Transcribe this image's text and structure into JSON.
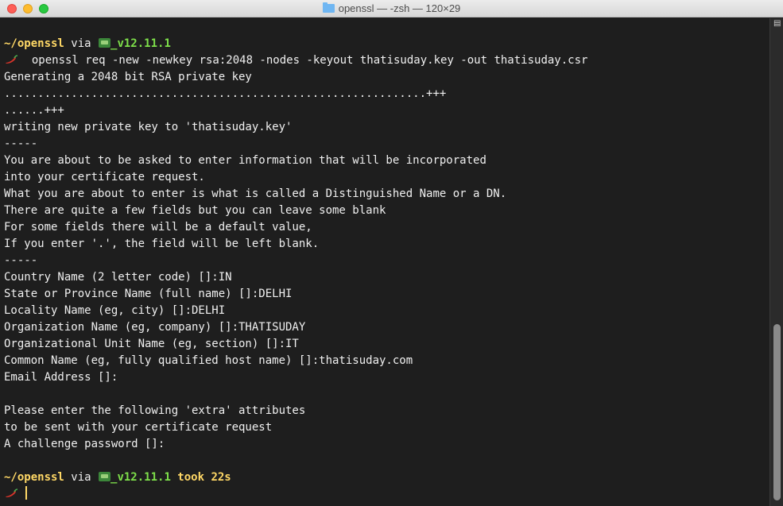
{
  "window": {
    "title": "openssl — -zsh — 120×29"
  },
  "prompt1": {
    "dir": "~/openssl",
    "via": " via ",
    "node_version": "_v12.11.1",
    "command": "  openssl req -new -newkey rsa:2048 -nodes -keyout thatisuday.key -out thatisuday.csr"
  },
  "output_lines": [
    "Generating a 2048 bit RSA private key",
    "...............................................................+++",
    "......+++",
    "writing new private key to 'thatisuday.key'",
    "-----",
    "You are about to be asked to enter information that will be incorporated",
    "into your certificate request.",
    "What you are about to enter is what is called a Distinguished Name or a DN.",
    "There are quite a few fields but you can leave some blank",
    "For some fields there will be a default value,",
    "If you enter '.', the field will be left blank.",
    "-----",
    "Country Name (2 letter code) []:IN",
    "State or Province Name (full name) []:DELHI",
    "Locality Name (eg, city) []:DELHI",
    "Organization Name (eg, company) []:THATISUDAY",
    "Organizational Unit Name (eg, section) []:IT",
    "Common Name (eg, fully qualified host name) []:thatisuday.com",
    "Email Address []:",
    "",
    "Please enter the following 'extra' attributes",
    "to be sent with your certificate request",
    "A challenge password []:"
  ],
  "prompt2": {
    "dir": "~/openssl",
    "via": " via ",
    "node_version": "_v12.11.1",
    "took": " took 22s"
  },
  "colors": {
    "background": "#1e1e1e",
    "text": "#f0f0f0",
    "directory": "#ffd866",
    "node_version": "#7ee04a",
    "chili": "#d8342a"
  },
  "icons": {
    "prompt_symbol": "chili-pepper-icon",
    "node": "node-icon",
    "folder": "folder-icon"
  }
}
